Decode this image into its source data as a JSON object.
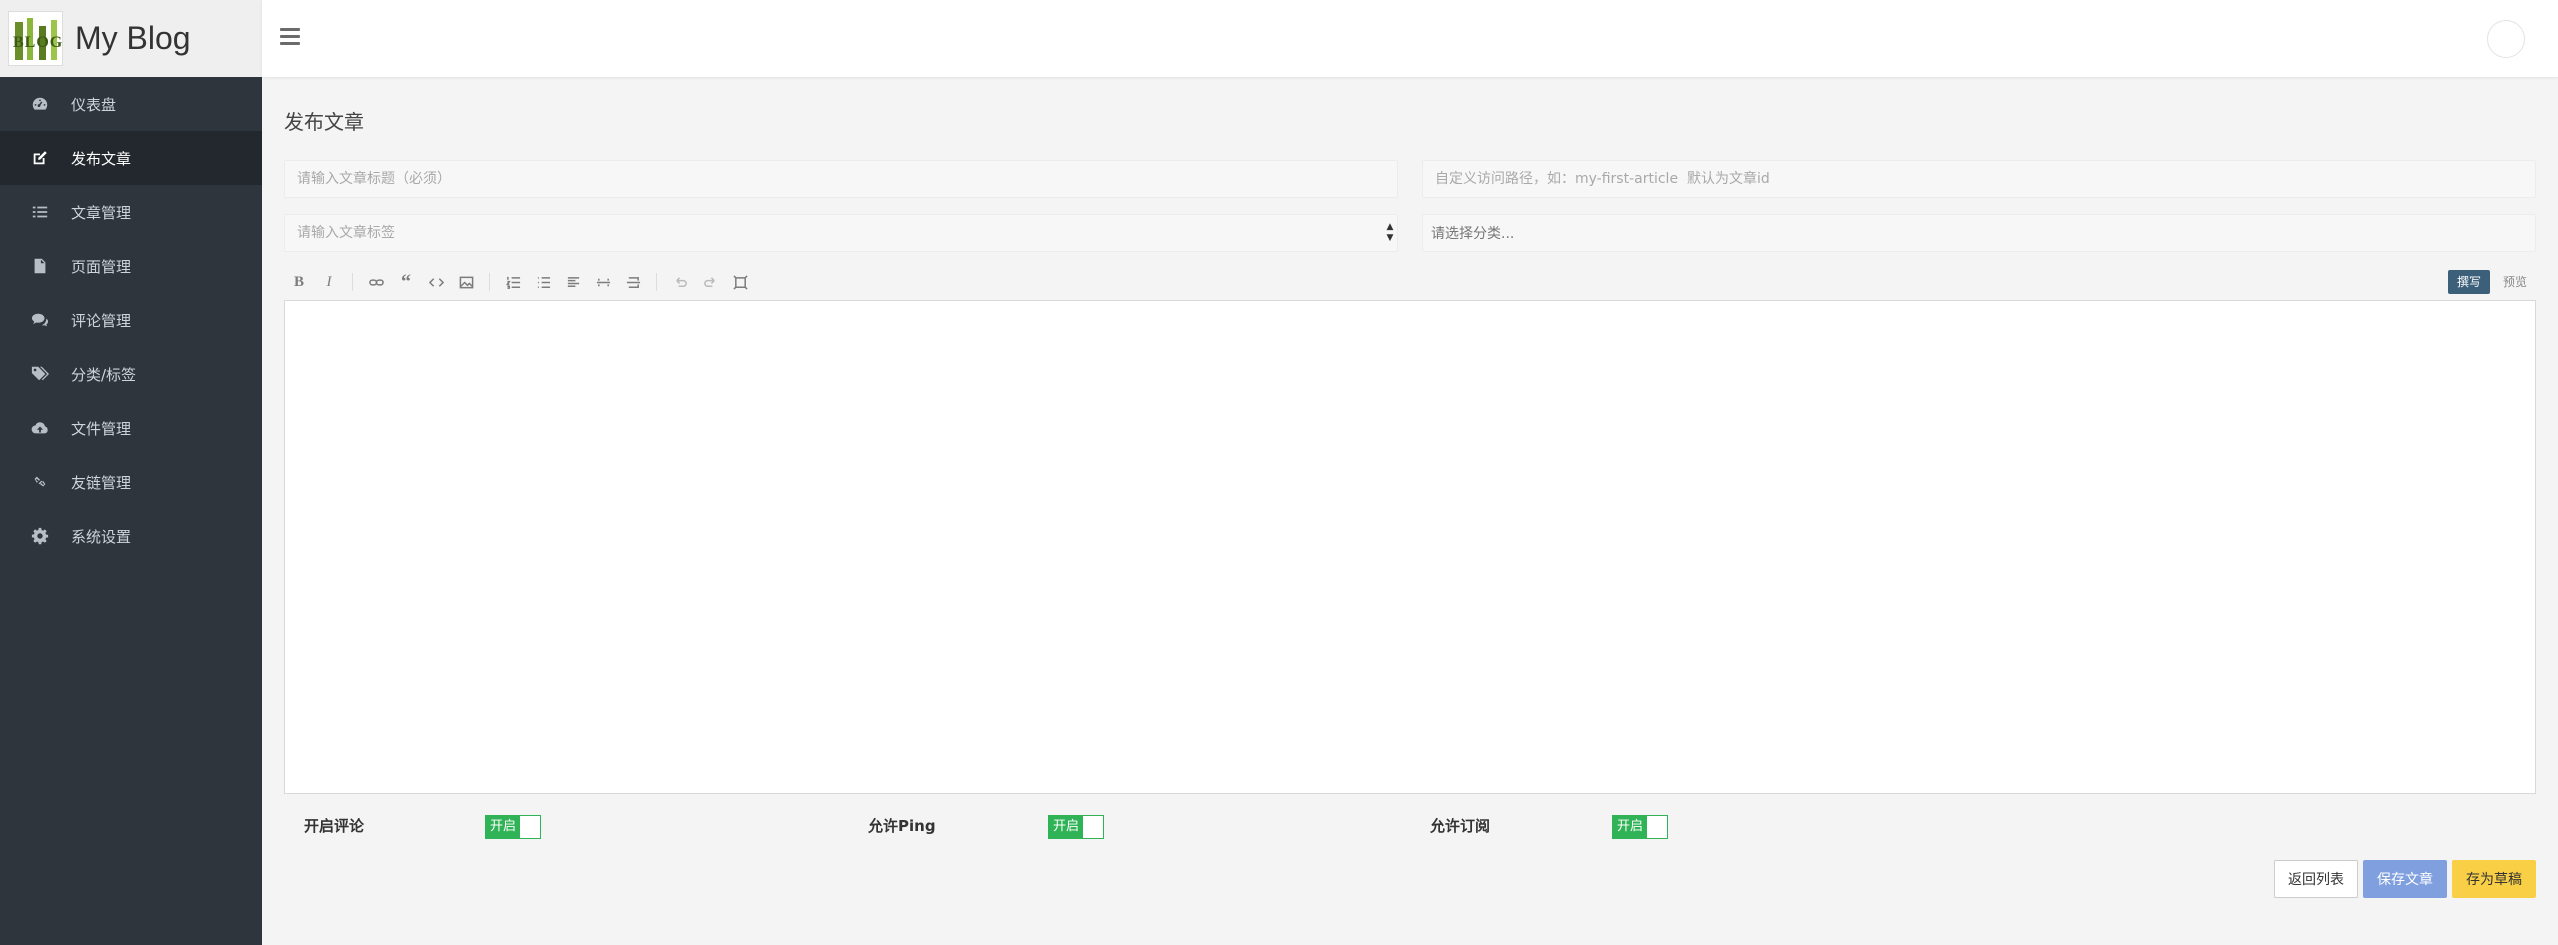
{
  "brand": {
    "title": "My Blog",
    "logo_text": "BLOG"
  },
  "sidebar": {
    "items": [
      {
        "label": "仪表盘",
        "icon": "dashboard-icon",
        "active": false
      },
      {
        "label": "发布文章",
        "icon": "edit-icon",
        "active": true
      },
      {
        "label": "文章管理",
        "icon": "list-icon",
        "active": false
      },
      {
        "label": "页面管理",
        "icon": "file-icon",
        "active": false
      },
      {
        "label": "评论管理",
        "icon": "comments-icon",
        "active": false
      },
      {
        "label": "分类/标签",
        "icon": "tags-icon",
        "active": false
      },
      {
        "label": "文件管理",
        "icon": "cloud-upload-icon",
        "active": false
      },
      {
        "label": "友链管理",
        "icon": "link-icon",
        "active": false
      },
      {
        "label": "系统设置",
        "icon": "gear-icon",
        "active": false
      }
    ]
  },
  "page": {
    "title": "发布文章"
  },
  "form": {
    "title_placeholder": "请输入文章标题（必须）",
    "slug_placeholder": "自定义访问路径，如：my-first-article  默认为文章id",
    "tags_placeholder": "请输入文章标签",
    "category_placeholder": "请选择分类..."
  },
  "editor": {
    "mode_write": "撰写",
    "mode_preview": "预览"
  },
  "options": {
    "comment_label": "开启评论",
    "ping_label": "允许Ping",
    "subscribe_label": "允许订阅",
    "toggle_on_text": "开启"
  },
  "actions": {
    "back": "返回列表",
    "save": "保存文章",
    "draft": "存为草稿"
  },
  "colors": {
    "sidebar_bg": "#2f353d",
    "toggle_green": "#2fb356",
    "save_blue": "#7f9fdf",
    "draft_yellow": "#f9cf46",
    "write_mode": "#3c5f7a"
  }
}
